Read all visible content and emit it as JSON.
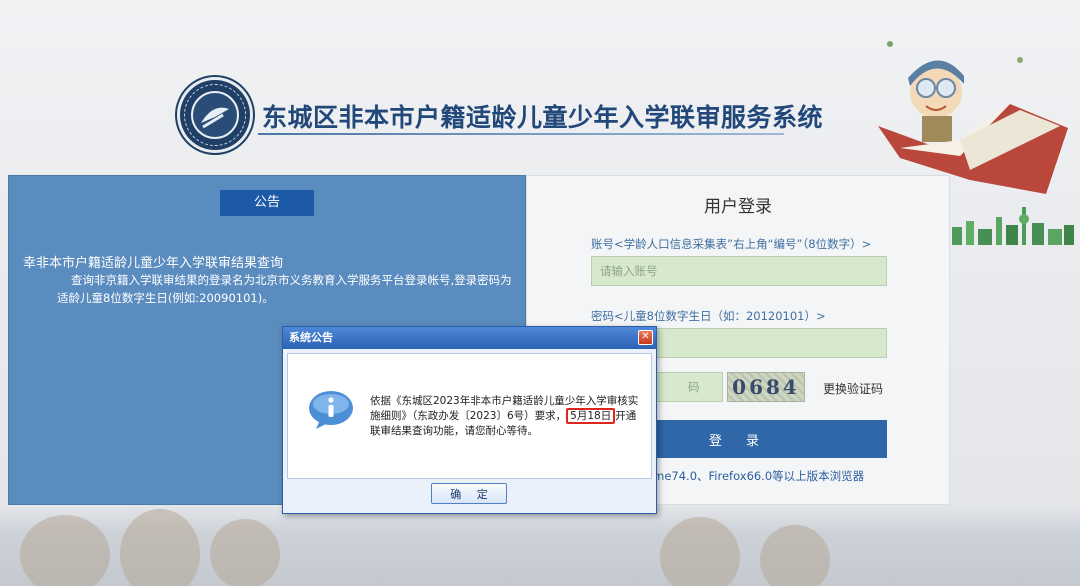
{
  "header": {
    "title": "东城区非本市户籍适龄儿童少年入学联审服务系统"
  },
  "notice": {
    "header_label": "公告",
    "title": "幸非本市户籍适龄儿童少年入学联审结果查询",
    "body": "查询非京籍入学联审结果的登录名为北京市义务教育入学服务平台登录帐号,登录密码为适龄儿童8位数字生日(例如:20090101)。"
  },
  "login": {
    "title": "用户登录",
    "account_label": "账号<学龄人口信息采集表”右上角“编号”（8位数字）>",
    "account_placeholder": "请输入账号",
    "password_label": "密码<儿童8位数字生日（如：20120101）>",
    "captcha_placeholder": "码",
    "captcha_text": "0684",
    "refresh_captcha": "更换验证码",
    "login_button": "登 录",
    "browser_tip": "oogle Chrome74.0、Firefox66.0等以上版本浏览器"
  },
  "dialog": {
    "title": "系统公告",
    "close_symbol": "✕",
    "message_before": "依据《东城区2023年非本市户籍适龄儿童少年入学审核实施细则》（东政办发〔2023〕6号）要求，",
    "message_highlight": "5月18日",
    "message_after": "开通联审结果查询功能，请您耐心等待。",
    "ok_button": "确 定"
  },
  "colors": {
    "panel_blue": "#5b8cbf",
    "button_blue": "#2f67a8",
    "field_green": "#d6e9cc",
    "highlight_red": "#e0261c"
  }
}
